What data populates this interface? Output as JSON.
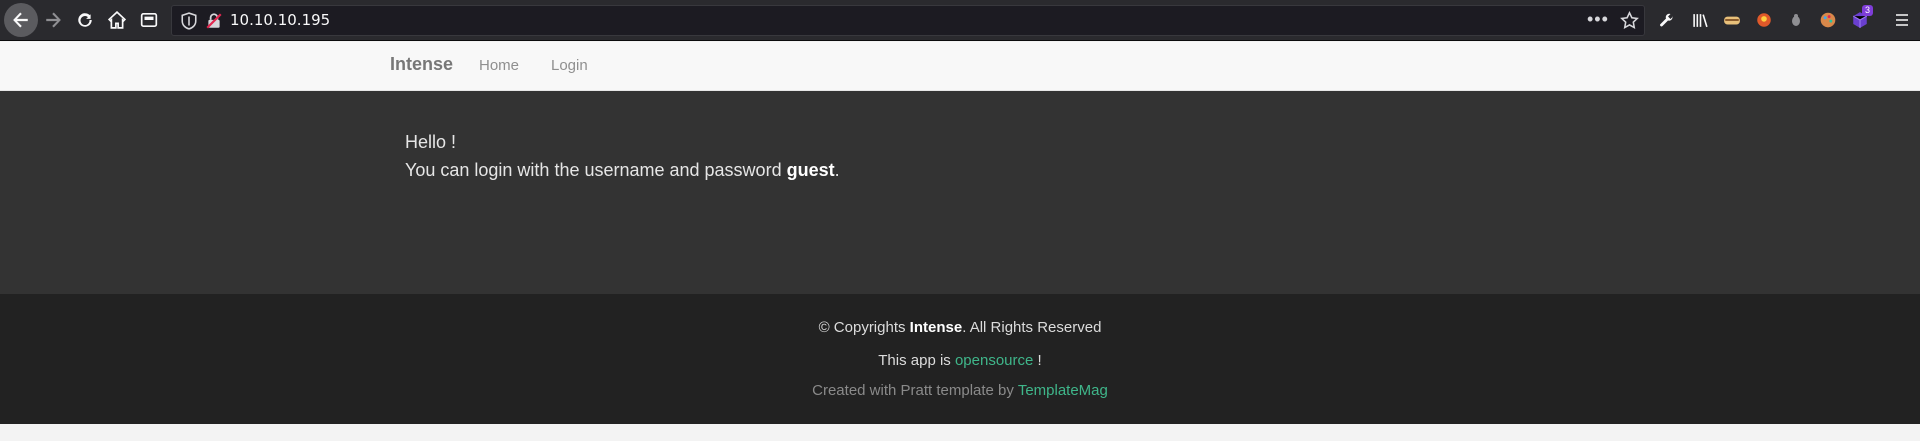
{
  "browser": {
    "url": "10.10.10.195",
    "extension_badge": "3"
  },
  "nav": {
    "brand": "Intense",
    "links": [
      "Home",
      "Login"
    ]
  },
  "hero": {
    "hello": "Hello !",
    "login_prefix": "You can login with the username and password ",
    "login_credential": "guest",
    "login_suffix": "."
  },
  "footer": {
    "copyright_prefix": "© Copyrights ",
    "copyright_brand": "Intense",
    "copyright_suffix": ". All Rights Reserved",
    "app_prefix": "This app is ",
    "app_link": "opensource",
    "app_suffix": " !",
    "credit_prefix": "Created with Pratt template by ",
    "credit_link": "TemplateMag"
  },
  "colors": {
    "hero_bg": "#333333",
    "footer_bg": "#222222",
    "link_green": "#3fb68a"
  }
}
